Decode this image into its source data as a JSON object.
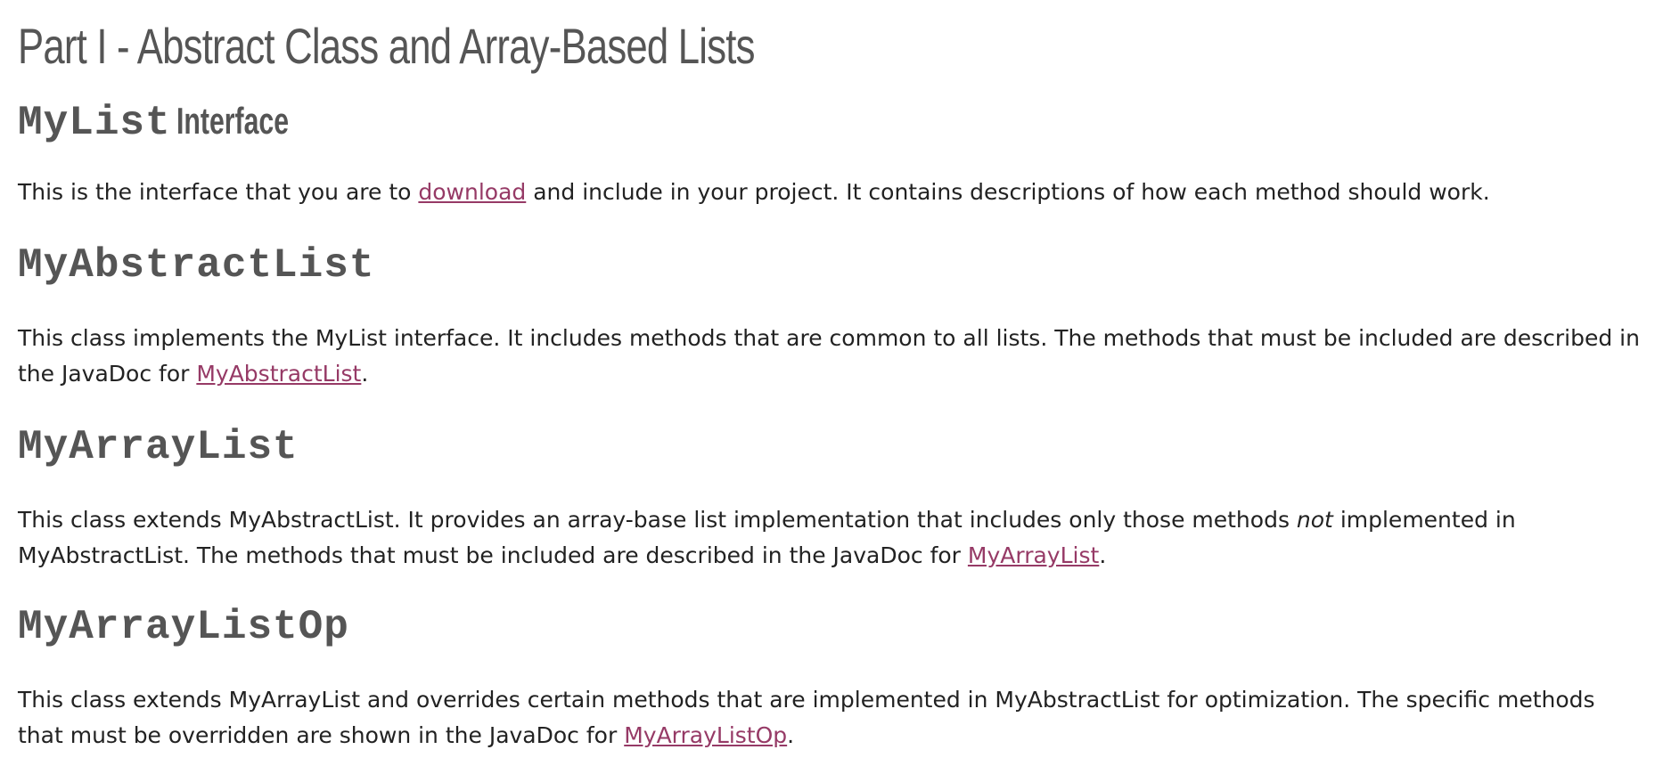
{
  "title": "Part I - Abstract Class and Array-Based Lists",
  "sections": [
    {
      "heading_code": "MyList",
      "heading_suffix": "Interface",
      "text_before": "This is the interface that you are to ",
      "link": "download",
      "text_after": " and include in your project. It contains descriptions of how each method should work."
    },
    {
      "heading_code": "MyAbstractList",
      "text_before": "This class implements the MyList interface. It includes methods that are common to all lists. The methods that must be included are described in the JavaDoc for ",
      "link": "MyAbstractList",
      "text_after": "."
    },
    {
      "heading_code": "MyArrayList",
      "text_before": "This class extends MyAbstractList. It provides an array-base list implementation that includes only those methods ",
      "emphasis": "not",
      "text_middle": " implemented in MyAbstractList. The methods that must be included are described in the JavaDoc for ",
      "link": "MyArrayList",
      "text_after": "."
    },
    {
      "heading_code": "MyArrayListOp",
      "text_before": "This class extends MyArrayList and overrides certain methods that are implemented in MyAbstractList for optimization. The specific methods that must be overridden are shown in the JavaDoc for ",
      "link": "MyArrayListOp",
      "text_after": "."
    }
  ],
  "colors": {
    "heading": "#555555",
    "text": "#222222",
    "link": "#963a66"
  }
}
